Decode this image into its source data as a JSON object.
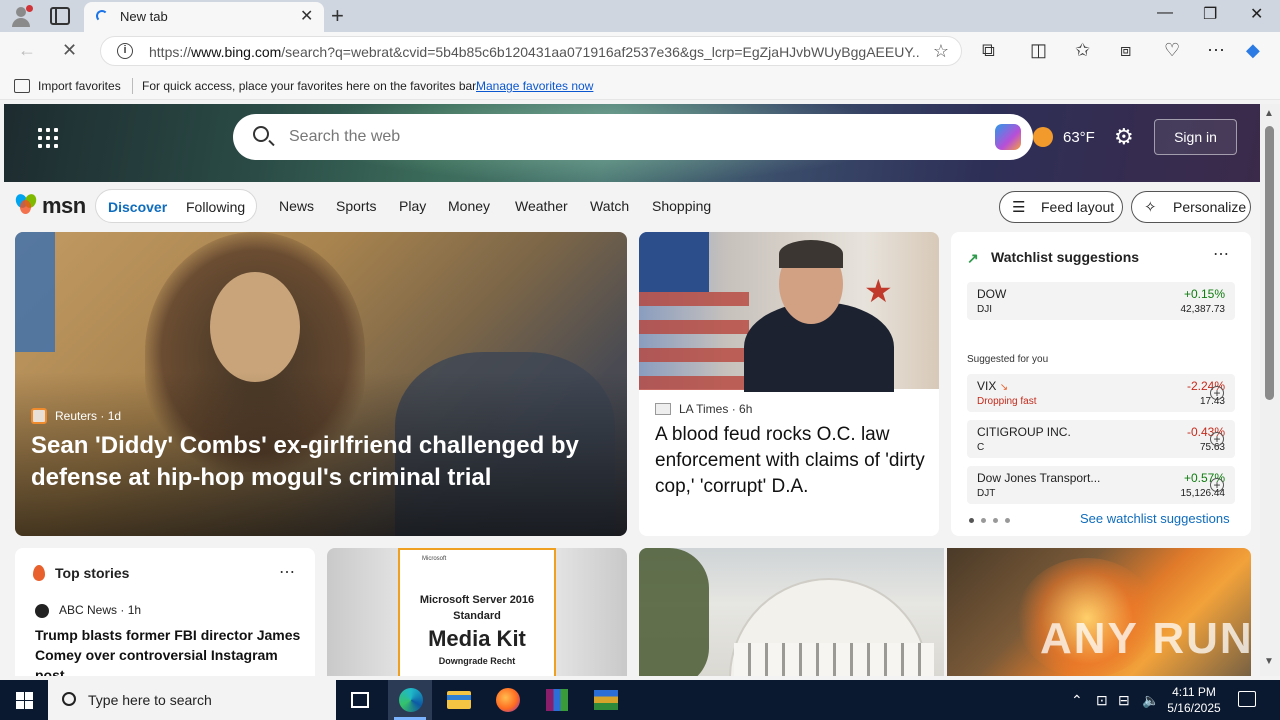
{
  "browser": {
    "tab_title": "New tab",
    "url_prefix": "https://",
    "url_domain": "www.bing.com",
    "url_rest": "/search?q=webrat&cvid=5b4b85c6b120431aa071916af2537e36&gs_lcrp=EgZjaHJvbWUyBggAEEUY..."
  },
  "favorites_bar": {
    "import_label": "Import favorites",
    "hint": "For quick access, place your favorites here on the favorites bar.",
    "manage_link": "Manage favorites now"
  },
  "header": {
    "search_placeholder": "Search the web",
    "temperature": "63°F",
    "sign_in": "Sign in"
  },
  "msn_nav": {
    "logo": "msn",
    "discover": "Discover",
    "following": "Following",
    "links": [
      "News",
      "Sports",
      "Play",
      "Money",
      "Weather",
      "Watch",
      "Shopping"
    ],
    "feed_layout": "Feed layout",
    "personalize": "Personalize"
  },
  "main_story": {
    "source": "Reuters",
    "age": "1d",
    "headline": "Sean 'Diddy' Combs' ex-girlfriend challenged by defense at hip-hop mogul's criminal trial"
  },
  "la_story": {
    "source": "LA Times",
    "age": "6h",
    "headline": "A blood feud rocks O.C. law enforcement with claims of 'dirty cop,' 'corrupt' D.A."
  },
  "watchlist": {
    "title": "Watchlist suggestions",
    "dow": {
      "name": "DOW",
      "symbol": "DJI",
      "change": "+0.15%",
      "price": "42,387.73"
    },
    "suggested_label": "Suggested for you",
    "items": [
      {
        "name": "VIX",
        "symbol": "Dropping fast",
        "change": "-2.24%",
        "price": "17.43"
      },
      {
        "name": "CITIGROUP INC.",
        "symbol": "C",
        "change": "-0.43%",
        "price": "75.63"
      },
      {
        "name": "Dow Jones Transport...",
        "symbol": "DJT",
        "change": "+0.57%",
        "price": "15,126.44"
      }
    ],
    "see_all": "See watchlist suggestions",
    "colors": {
      "up": "#0f7b0f",
      "down": "#c42b1c"
    }
  },
  "top_stories": {
    "title": "Top stories",
    "source": "ABC News",
    "age": "1h",
    "headline": "Trump blasts former FBI director James Comey over controversial Instagram post"
  },
  "ad": {
    "brand": "Microsoft",
    "line1": "Microsoft Server 2016",
    "line2": "Standard",
    "line3": "Media Kit",
    "line4": "Downgrade Recht"
  },
  "watermark": "ANY RUN",
  "taskbar": {
    "search_placeholder": "Type here to search",
    "time": "4:11 PM",
    "date": "5/16/2025"
  }
}
